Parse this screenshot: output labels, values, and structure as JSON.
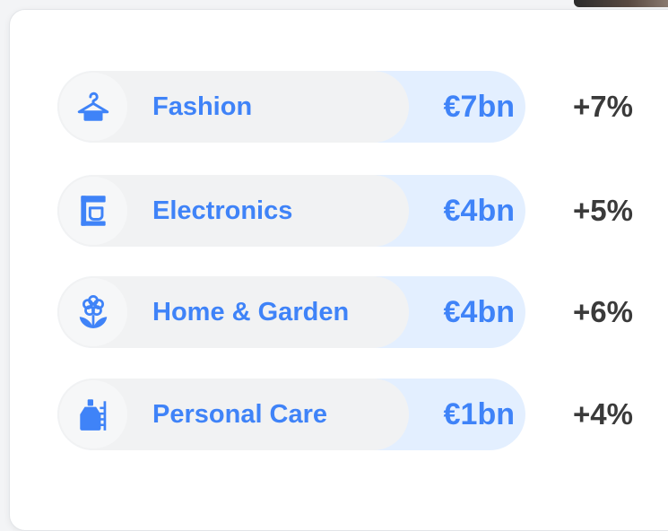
{
  "colors": {
    "accent": "#3f83f8",
    "value_pill": "#e3efff",
    "label_pill": "#f1f2f3",
    "change_text": "#3a3a3a"
  },
  "categories": [
    {
      "icon": "hanger-icon",
      "label": "Fashion",
      "value": "€7bn",
      "change": "+7%"
    },
    {
      "icon": "appliance-icon",
      "label": "Electronics",
      "value": "€4bn",
      "change": "+5%"
    },
    {
      "icon": "flower-icon",
      "label": "Home & Garden",
      "value": "€4bn",
      "change": "+6%"
    },
    {
      "icon": "perfume-icon",
      "label": "Personal Care",
      "value": "€1bn",
      "change": "+4%"
    }
  ]
}
